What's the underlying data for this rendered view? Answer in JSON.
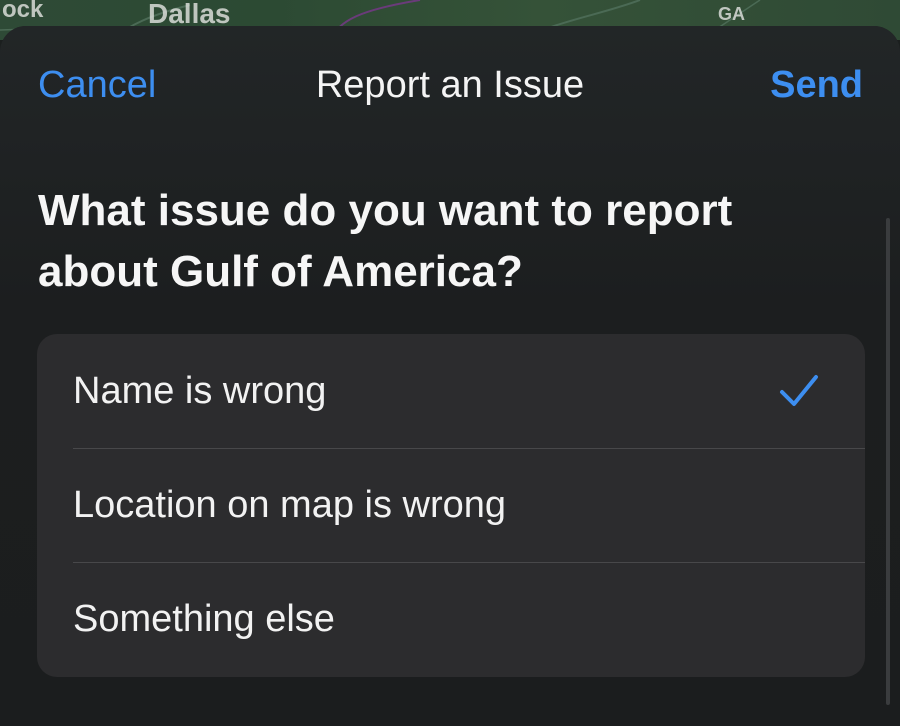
{
  "map": {
    "labels": [
      "ock",
      "Dallas",
      "GA"
    ]
  },
  "nav": {
    "cancel_label": "Cancel",
    "title": "Report an Issue",
    "send_label": "Send"
  },
  "question": "What issue do you want to report about Gulf of America?",
  "options": [
    {
      "label": "Name is wrong",
      "selected": true
    },
    {
      "label": "Location on map is wrong",
      "selected": false
    },
    {
      "label": "Something else",
      "selected": false
    }
  ],
  "colors": {
    "accent": "#3d8ef0",
    "sheet_background": "#1d1f20",
    "option_group_background": "#2c2c2e",
    "text": "#f2f2f2"
  },
  "icons": {
    "selected_indicator": "checkmark-icon"
  }
}
